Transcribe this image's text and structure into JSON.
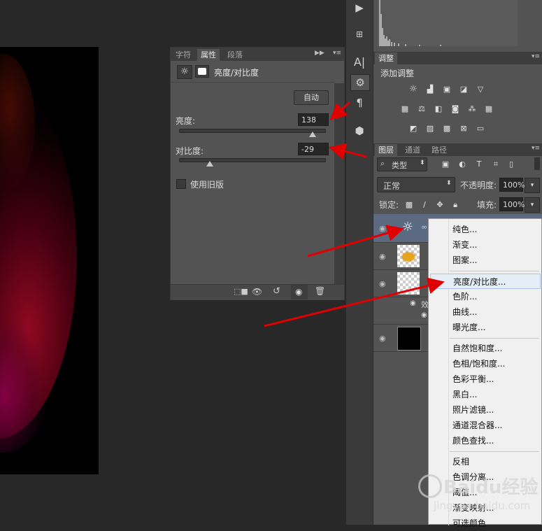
{
  "colors": {
    "arrow": "#e00000",
    "panel_bg": "#535353",
    "dark_bg": "#282828",
    "menu_bg": "#f0f0f0",
    "menu_highlight": "#e5edf7"
  },
  "properties_panel": {
    "tabs": [
      "字符",
      "属性",
      "段落"
    ],
    "active_tab": "属性",
    "title": "亮度/对比度",
    "auto_button": "自动",
    "brightness": {
      "label": "亮度:",
      "value": "138",
      "level": 0.92
    },
    "contrast": {
      "label": "对比度:",
      "value": "-29",
      "level": 0.21
    },
    "legacy_checkbox": "使用旧版"
  },
  "adjustments_panel": {
    "tab": "调整",
    "title": "添加调整"
  },
  "layers_panel": {
    "tabs": [
      "图层",
      "通道",
      "路径"
    ],
    "filter_kind": "类型",
    "blend_mode": "正常",
    "opacity_label": "不透明度:",
    "opacity_value": "100%",
    "lock_label": "锁定:",
    "fill_label": "填充:",
    "fill_value": "100%",
    "sublayer_text": "效"
  },
  "context_menu": {
    "items": [
      "纯色...",
      "渐变...",
      "图案...",
      "亮度/对比度...",
      "色阶...",
      "曲线...",
      "曝光度...",
      "自然饱和度...",
      "色相/饱和度...",
      "色彩平衡...",
      "黑白...",
      "照片滤镜...",
      "通道混合器...",
      "颜色查找...",
      "反相",
      "色调分离...",
      "阈值...",
      "渐变映射...",
      "可选颜色"
    ],
    "highlighted": "亮度/对比度..."
  },
  "watermark": {
    "brand": "Baidu经验",
    "url": "jingyan.baidu.com"
  }
}
